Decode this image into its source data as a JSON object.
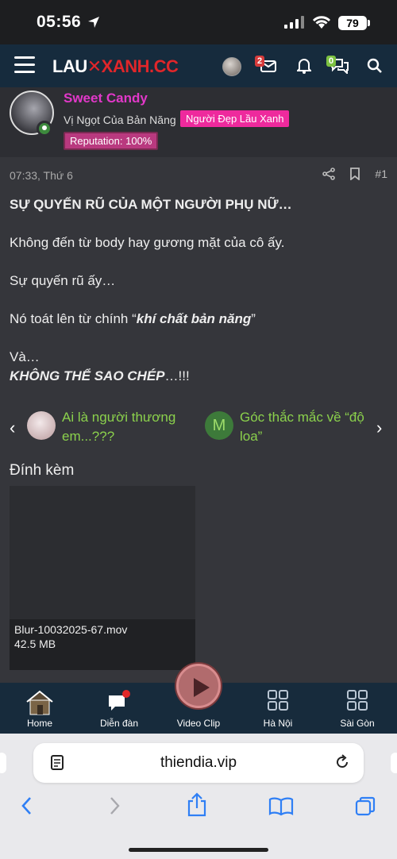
{
  "status_bar": {
    "time": "05:56",
    "battery": "79"
  },
  "header": {
    "logo_part1": "LAU",
    "logo_part2": "XANH.CC",
    "notif_count": "2",
    "chat_count": "0"
  },
  "author": {
    "name": "Sweet Candy",
    "tagline": "Vị Ngọt Của Bản Năng",
    "title_badge": "Người Đẹp Lầu Xanh",
    "reputation": "Reputation: 100%"
  },
  "post": {
    "timestamp": "07:33, Thứ 6",
    "number": "#1",
    "heading": "SỰ QUYẾN RŨ CỦA MỘT NGƯỜI PHỤ NỮ…",
    "p1": "Không đến từ body hay gương mặt của cô ấy.",
    "p2": "Sự quyến rũ ấy…",
    "p3_prefix": "Nó toát lên từ chính “",
    "p3_emph": "khí chất bản năng",
    "p3_suffix": "”",
    "p4_line1": "Và…",
    "p4_emph": "KHÔNG THỂ SAO CHÉP",
    "p4_suffix": "…!!!"
  },
  "thread_nav": {
    "prev_title": "Ai là người thương em...???",
    "next_avatar_letter": "M",
    "next_title": "Góc thắc mắc về “độ loa”"
  },
  "attachments": {
    "title": "Đính kèm",
    "file_name": "Blur-10032025-67.mov",
    "file_size": "42.5 MB"
  },
  "bottom_nav": {
    "home": "Home",
    "forum": "Diễn đàn",
    "video": "Video Clip",
    "hanoi": "Hà Nội",
    "saigon": "Sài Gòn"
  },
  "browser": {
    "url": "thiendia.vip"
  }
}
